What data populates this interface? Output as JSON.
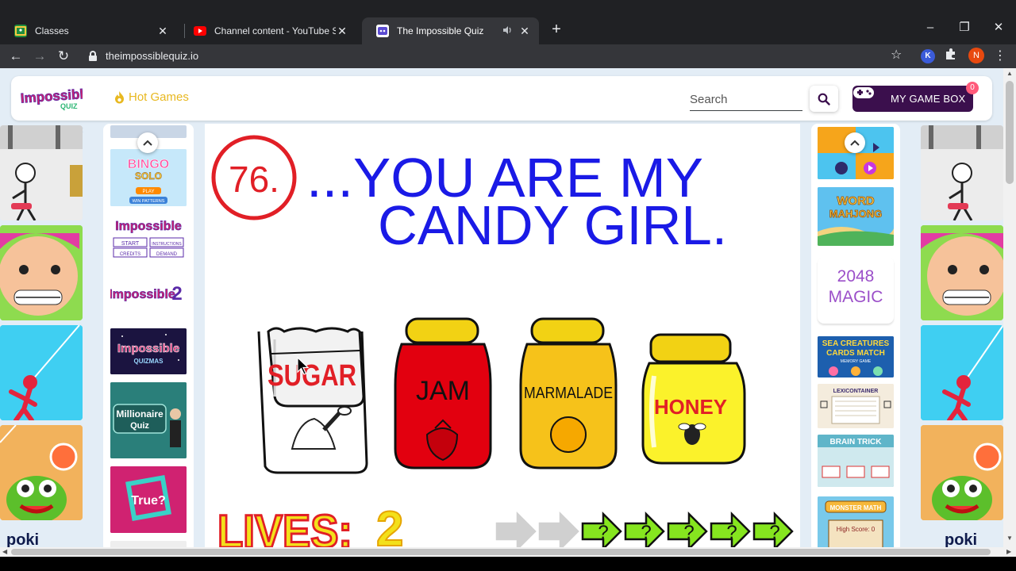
{
  "browser": {
    "tabs": [
      {
        "title": "Classes",
        "favicon": "classroom-icon",
        "color": "#fbbc04"
      },
      {
        "title": "Channel content - YouTube Studio",
        "favicon": "youtube-icon",
        "color": "#ff0000"
      },
      {
        "title": "The Impossible Quiz",
        "favicon": "quiz-icon",
        "color": "#5b4bd1"
      }
    ],
    "url": "theimpossiblequiz.io",
    "profile_initial": "N",
    "extension_initial": "K"
  },
  "header": {
    "hot_games": "Hot Games",
    "search_placeholder": "Search",
    "my_game_box": "MY GAME BOX",
    "game_box_count": "0"
  },
  "side_ads": {
    "brand": "poki",
    "close_glyph": "✕"
  },
  "left_rail": {
    "thumbs": [
      {
        "name": "bingo-solo",
        "line1": "BINGO",
        "line2": "SOLO",
        "btn1": "PLAY",
        "btn2": "WIN PATTERNS"
      },
      {
        "name": "impossible-quiz",
        "line1": "Impossible",
        "btn1": "START",
        "btn2": "INSTRUCTIONS",
        "btn3": "CREDITS",
        "btn4": "DEMAND"
      },
      {
        "name": "impossible-quiz-2",
        "line1": "Impossible",
        "line2": "2"
      },
      {
        "name": "impossible-quizmas",
        "line1": "Impossible",
        "line2": "QUIZMAS"
      },
      {
        "name": "millionaire-quiz",
        "line1": "Millionaire",
        "line2": "Quiz"
      },
      {
        "name": "true-or-false",
        "line1": "True?"
      }
    ]
  },
  "right_rail": {
    "thumbs": [
      {
        "name": "arcade"
      },
      {
        "name": "word-mahjong",
        "line1": "WORD",
        "line2": "MAHJONG"
      },
      {
        "name": "2048-magic",
        "line1": "2048",
        "line2": "MAGIC"
      },
      {
        "name": "sea-creatures",
        "line1": "SEA CREATURES",
        "line2": "CARDS MATCH",
        "line3": "MEMORY GAME"
      },
      {
        "name": "lexicontainer",
        "line1": "LEXICONTAINER"
      },
      {
        "name": "brain-trick",
        "line1": "BRAIN TRICK"
      },
      {
        "name": "monster-math",
        "line1": "MONSTER MATH",
        "line2": "High Score: 0"
      }
    ]
  },
  "game": {
    "question_number": "76.",
    "question_line1": "...YOU ARE MY",
    "question_line2": "CANDY GIRL.",
    "answers": [
      {
        "label": "SUGAR",
        "kind": "bag"
      },
      {
        "label": "JAM",
        "kind": "jar-red"
      },
      {
        "label": "MARMALADE",
        "kind": "jar-orange"
      },
      {
        "label": "HONEY",
        "kind": "jar-yellow"
      }
    ],
    "lives_label": "LIVES:",
    "lives_value": "2",
    "skip_arrows_used": 2,
    "skip_arrows_available": 5,
    "skip_glyph": "?"
  }
}
